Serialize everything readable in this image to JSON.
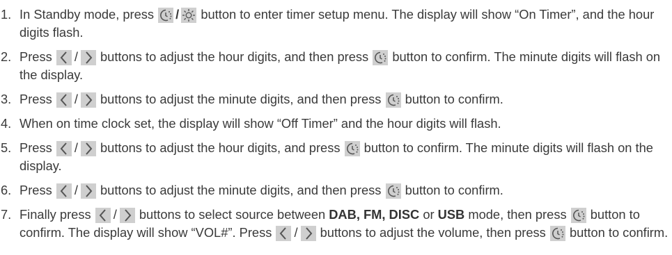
{
  "colors": {
    "text": "#3a3a3a",
    "button_bg": "#cfcfcf",
    "icon": "#555555"
  },
  "icons": {
    "timer": "timer-clock-icon",
    "dimmer": "brightness-sun-icon",
    "left": "chevron-left-icon",
    "right": "chevron-right-icon"
  },
  "steps": [
    {
      "num": "1.",
      "t1": "In Standby mode, press ",
      "slash": "/",
      "t2": " button to enter timer setup menu. The display will show “On Timer”, and the hour digits flash."
    },
    {
      "num": "2.",
      "t1": "Press ",
      "slash": "/",
      "t2": " buttons to adjust the hour digits, and then press ",
      "t3": " button to confirm. The minute digits will flash on the display."
    },
    {
      "num": "3.",
      "t1": "Press ",
      "slash": "/",
      "t2": " buttons to adjust the minute digits, and then press ",
      "t3": " button to confirm."
    },
    {
      "num": "4.",
      "t1": "When on time clock set, the display will show “Off Timer” and the hour digits will flash."
    },
    {
      "num": "5.",
      "t1": "Press ",
      "slash": "/",
      "t2": " buttons to adjust the hour digits, and press ",
      "t3": " button to confirm. The minute digits will flash on the display."
    },
    {
      "num": "6.",
      "t1": "Press ",
      "slash": "/",
      "t2": " buttons to adjust the minute digits, and then press ",
      "t3": " button to confirm."
    },
    {
      "num": "7.",
      "t1": "Finally press ",
      "slash": "/",
      "t2": " buttons to select source between ",
      "b1": "DAB, FM, DISC",
      "t3": " or ",
      "b2": "USB",
      "t4": " mode, then press ",
      "t5": " button to confirm. The display will show “VOL#”. Press ",
      "slash2": "/",
      "t6": " buttons to adjust the volume, then press ",
      "t7": " button to confirm."
    }
  ]
}
